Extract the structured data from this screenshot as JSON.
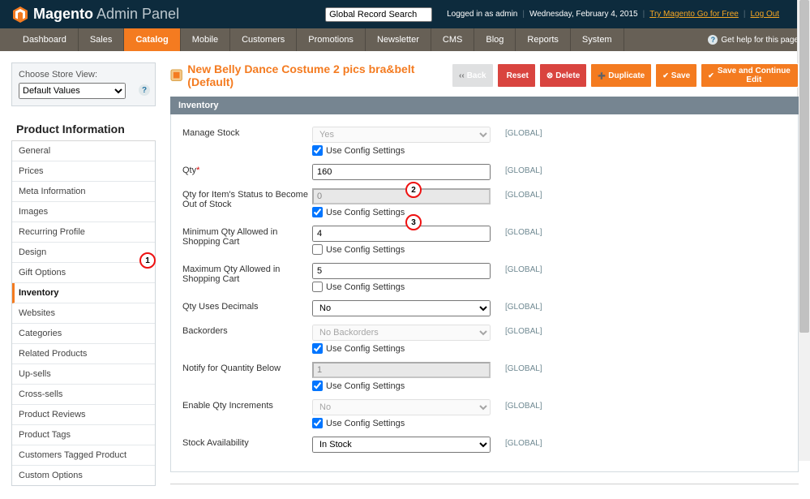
{
  "header": {
    "panel_strong": "Magento",
    "panel_light": " Admin Panel",
    "search_placeholder": "Global Record Search",
    "logged_in": "Logged in as admin",
    "date": "Wednesday, February 4, 2015",
    "try_link": "Try Magento Go for Free",
    "logout": "Log Out"
  },
  "nav": {
    "items": [
      "Dashboard",
      "Sales",
      "Catalog",
      "Mobile",
      "Customers",
      "Promotions",
      "Newsletter",
      "CMS",
      "Blog",
      "Reports",
      "System"
    ],
    "active_index": 2,
    "help": "Get help for this page"
  },
  "store": {
    "label": "Choose Store View:",
    "value": "Default Values"
  },
  "sidebar": {
    "title": "Product Information",
    "tabs": [
      "General",
      "Prices",
      "Meta Information",
      "Images",
      "Recurring Profile",
      "Design",
      "Gift Options",
      "Inventory",
      "Websites",
      "Categories",
      "Related Products",
      "Up-sells",
      "Cross-sells",
      "Product Reviews",
      "Product Tags",
      "Customers Tagged Product",
      "Custom Options"
    ],
    "selected_index": 7
  },
  "page": {
    "title": "New Belly Dance Costume 2 pics bra&belt (Default)",
    "buttons": {
      "back": "Back",
      "reset": "Reset",
      "delete": "Delete",
      "duplicate": "Duplicate",
      "save": "Save",
      "save_edit": "Save and Continue Edit"
    }
  },
  "fieldset": {
    "legend": "Inventory",
    "scope": "[GLOBAL]",
    "use_config": "Use Config Settings",
    "rows": {
      "manage": {
        "label": "Manage Stock",
        "value": "Yes",
        "cfg": true
      },
      "qty": {
        "label": "Qty",
        "req": "*",
        "value": "160"
      },
      "qty_oos": {
        "label": "Qty for Item's Status to Become Out of Stock",
        "value": "0",
        "cfg": true
      },
      "min_qty": {
        "label": "Minimum Qty Allowed in Shopping Cart",
        "value": "4",
        "cfg": false
      },
      "max_qty": {
        "label": "Maximum Qty Allowed in Shopping Cart",
        "value": "5",
        "cfg": false
      },
      "dec": {
        "label": "Qty Uses Decimals",
        "value": "No"
      },
      "backorders": {
        "label": "Backorders",
        "value": "No Backorders",
        "cfg": true
      },
      "notify": {
        "label": "Notify for Quantity Below",
        "value": "1",
        "cfg": true
      },
      "incr": {
        "label": "Enable Qty Increments",
        "value": "No",
        "cfg": true
      },
      "avail": {
        "label": "Stock Availability",
        "value": "In Stock"
      }
    }
  },
  "callouts": {
    "c1": "1",
    "c2": "2",
    "c3": "3"
  }
}
